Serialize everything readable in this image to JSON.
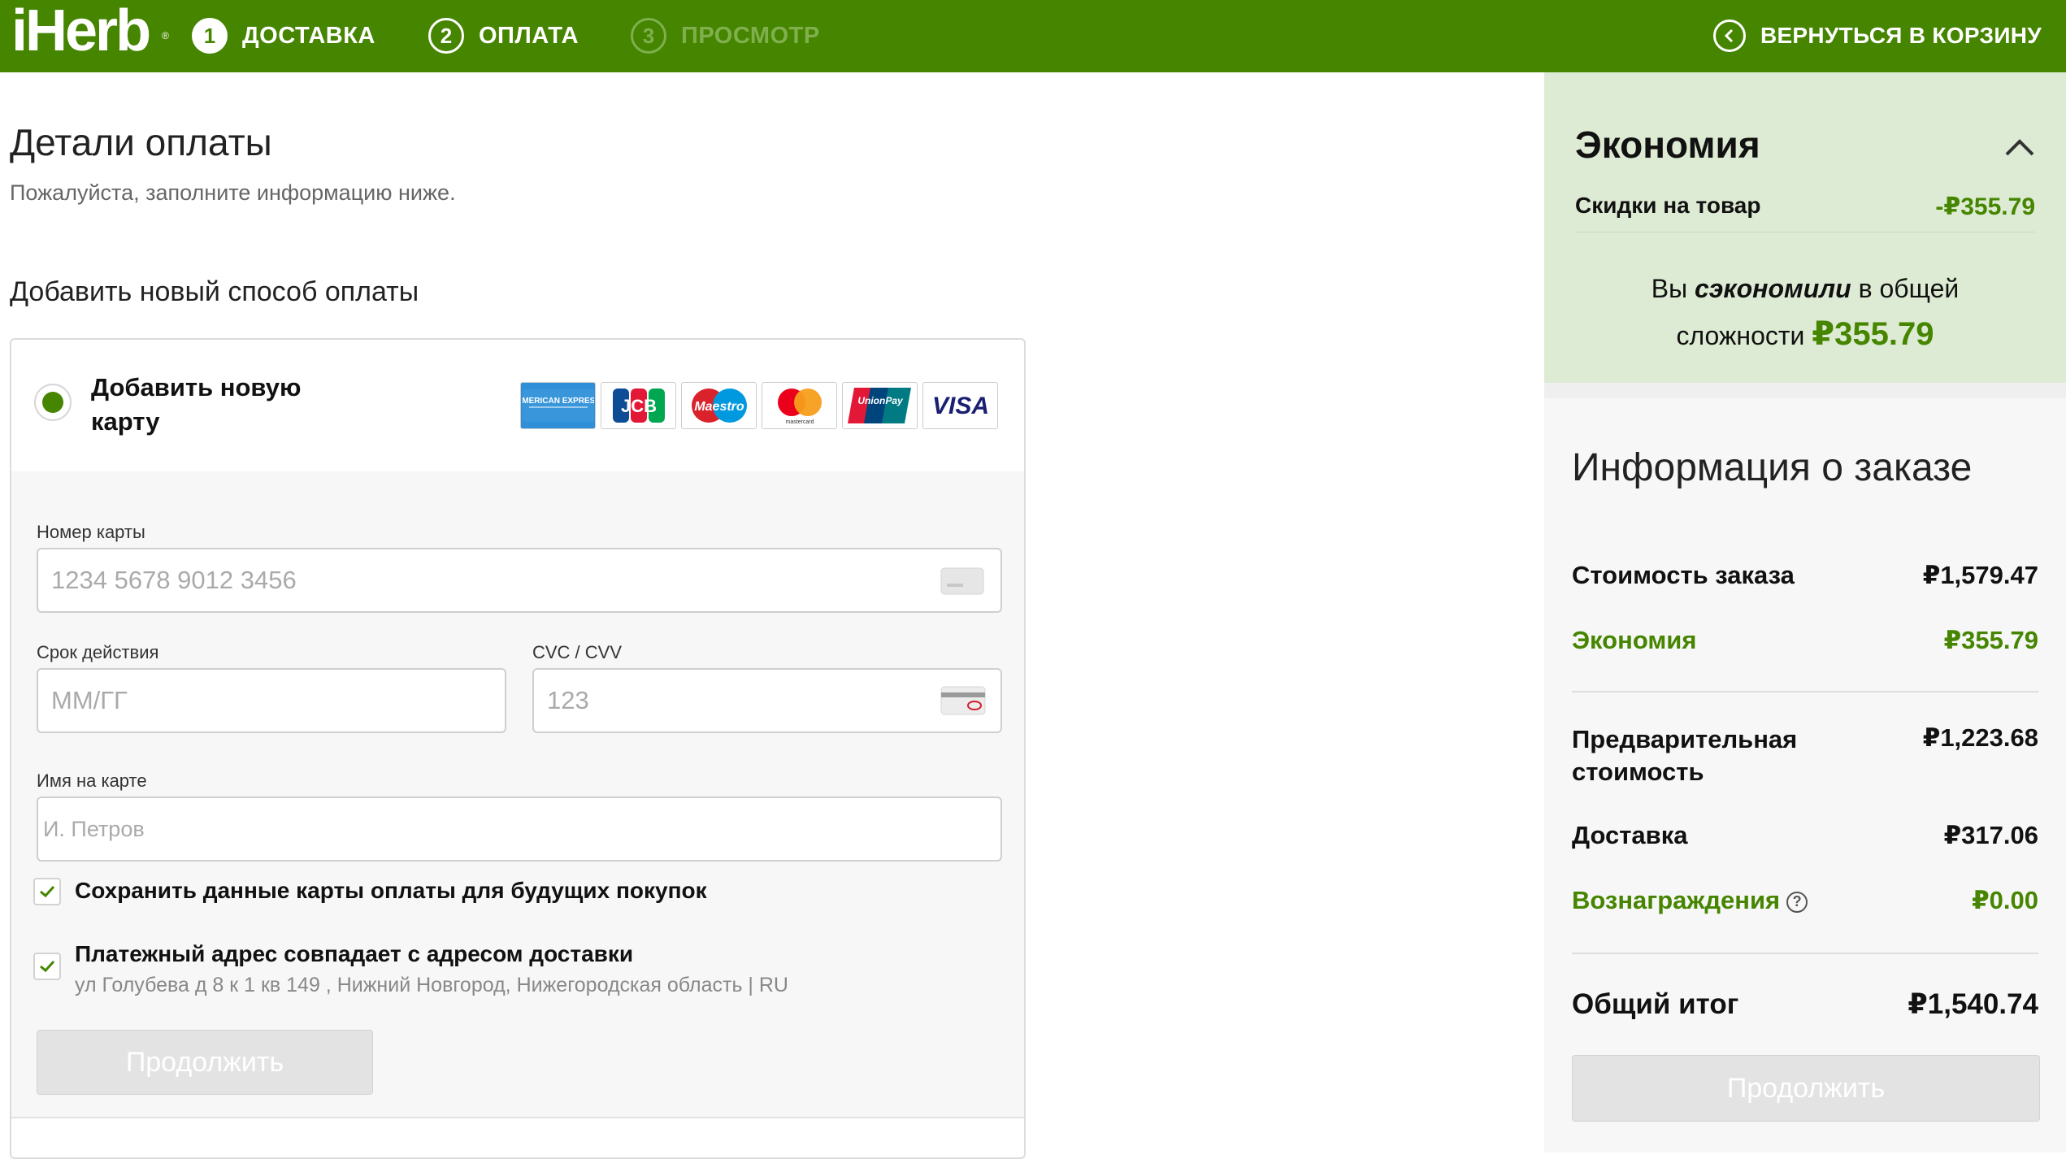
{
  "header": {
    "logo": "iHerb",
    "logo_mark": "®",
    "steps": [
      {
        "num": "1",
        "label": "ДОСТАВКА"
      },
      {
        "num": "2",
        "label": "ОПЛАТА"
      },
      {
        "num": "3",
        "label": "ПРОСМОТР"
      }
    ],
    "back_label": "ВЕРНУТЬСЯ В КОРЗИНУ"
  },
  "payment": {
    "title": "Детали оплаты",
    "subtitle": "Пожалуйста, заполните информацию ниже.",
    "add_method_title": "Добавить новый способ оплаты",
    "new_card_label": "Добавить новую карту",
    "card_brands": [
      "AMERICAN EXPRESS",
      "JCB",
      "Maestro",
      "mastercard",
      "UnionPay",
      "VISA"
    ],
    "card_number": {
      "label": "Номер карты",
      "placeholder": "1234 5678 9012 3456",
      "value": ""
    },
    "expiry": {
      "label": "Срок действия",
      "placeholder": "ММ/ГГ",
      "value": ""
    },
    "cvc": {
      "label": "CVC / CVV",
      "placeholder": "123",
      "value": ""
    },
    "name": {
      "label": "Имя на карте",
      "placeholder": "И. Петров",
      "value": ""
    },
    "save_card": {
      "label": "Сохранить данные карты оплаты для будущих покупок",
      "checked": true
    },
    "billing_same": {
      "label": "Платежный адрес совпадает с адресом доставки",
      "checked": true
    },
    "address": "ул Голубева д 8 к 1 кв 149 , Нижний Новгород, Нижегородская область | RU",
    "continue_label": "Продолжить"
  },
  "savings": {
    "title": "Экономия",
    "discount_label": "Скидки на товар",
    "discount_value": "-₽355.79",
    "total_pre": "Вы",
    "total_em": "сэкономили",
    "total_mid": "в общей",
    "total_post": "сложности",
    "total_value": "₽355.79"
  },
  "order": {
    "title": "Информация о заказе",
    "rows": [
      {
        "label": "Стоимость заказа",
        "value": "₽1,579.47"
      },
      {
        "label": "Экономия",
        "value": "₽355.79"
      },
      {
        "label": "Предварительная стоимость",
        "value": "₽1,223.68"
      },
      {
        "label": "Доставка",
        "value": "₽317.06"
      },
      {
        "label": "Вознаграждения",
        "value": "₽0.00"
      }
    ],
    "help_glyph": "?",
    "total_label": "Общий итог",
    "total_value": "₽1,540.74",
    "continue_label": "Продолжить"
  },
  "colors": {
    "brand_green": "#458500",
    "savings_bg": "#deebd4",
    "header_text": "#ffffff"
  }
}
